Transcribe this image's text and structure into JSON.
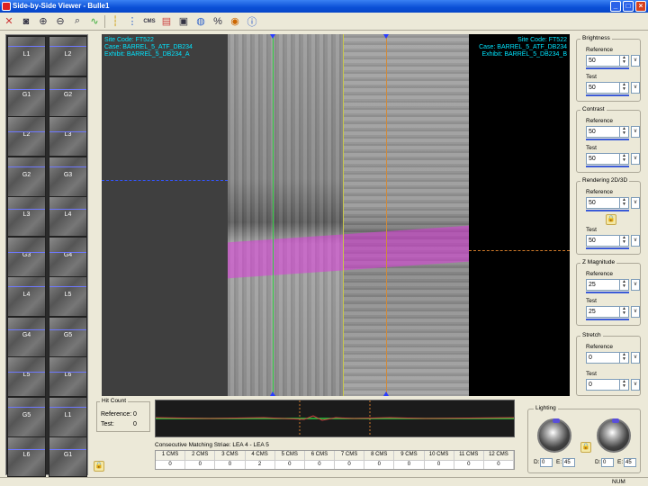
{
  "window": {
    "title": "Side-by-Side Viewer - Bulle1"
  },
  "toolbar": {
    "icons": [
      "close-x-icon",
      "camera-icon",
      "zoom-in-icon",
      "zoom-out-icon",
      "zoom-icon",
      "waveform-icon",
      "vertical-line-icon",
      "dotted-line-icon",
      "cms-icon",
      "gradient-icon",
      "compare-icon",
      "globe-icon",
      "percent-icon",
      "refresh-icon",
      "help-icon"
    ],
    "cms_label": "CMS",
    "percent_label": "%"
  },
  "thumbnails": {
    "left": [
      "L1",
      "G1",
      "L2",
      "G2",
      "L3",
      "G3",
      "L4",
      "G4",
      "L5",
      "G5",
      "L6"
    ],
    "right": [
      "L2",
      "G2",
      "L3",
      "G3",
      "L4",
      "G4",
      "L5",
      "G5",
      "L6",
      "L1",
      "G1"
    ]
  },
  "viewer": {
    "left_info": {
      "site": "Site Code: FT522",
      "case": "Case: BARREL_5_ATF_DB234",
      "exhibit": "Exhibit: BARREL_5_DB234_A"
    },
    "right_info": {
      "site": "Site Code: FT522",
      "case": "Case: BARREL_5_ATF_DB234",
      "exhibit": "Exhibit: BARREL_5_DB234_B"
    }
  },
  "brightness": {
    "title": "Brightness",
    "reference_label": "Reference",
    "reference_value": "50",
    "test_label": "Test",
    "test_value": "50"
  },
  "contrast": {
    "title": "Contrast",
    "reference_label": "Reference",
    "reference_value": "50",
    "test_label": "Test",
    "test_value": "50"
  },
  "rendering": {
    "title": "Rendering 2D/3D",
    "reference_label": "Reference",
    "reference_value": "50",
    "test_label": "Test",
    "test_value": "50"
  },
  "zmag": {
    "title": "Z Magnitude",
    "reference_label": "Reference",
    "reference_value": "25",
    "test_label": "Test",
    "test_value": "25"
  },
  "stretch": {
    "title": "Stretch",
    "reference_label": "Reference",
    "reference_value": "0",
    "test_label": "Test",
    "test_value": "0"
  },
  "v_label": "v",
  "hitcount": {
    "title": "Hit Count",
    "reference_label": "Reference:",
    "reference_value": "0",
    "test_label": "Test:",
    "test_value": "0"
  },
  "striae": {
    "label": "Consecutive Matching Striae: LEA 4 - LEA 5",
    "headers": [
      "1 CMS",
      "2 CMS",
      "3 CMS",
      "4 CMS",
      "5 CMS",
      "6 CMS",
      "7 CMS",
      "8 CMS",
      "9 CMS",
      "10 CMS",
      "11 CMS",
      "12 CMS"
    ],
    "values": [
      "0",
      "0",
      "0",
      "2",
      "0",
      "0",
      "0",
      "0",
      "0",
      "0",
      "0",
      "0"
    ]
  },
  "lighting": {
    "title": "Lighting",
    "d_label": "D:",
    "e_label": "E:",
    "left_d": "0",
    "left_e": "45",
    "right_d": "0",
    "right_e": "45"
  },
  "status": {
    "num": "NUM"
  }
}
